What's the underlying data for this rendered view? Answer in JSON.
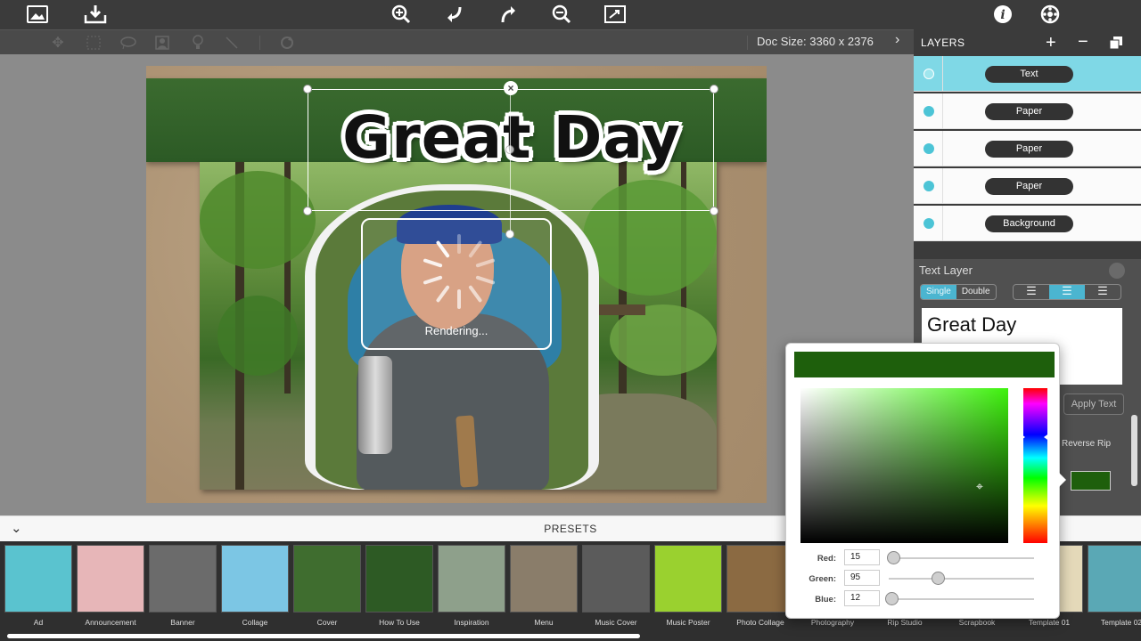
{
  "colors": {
    "accent": "#4bb5d0",
    "selected_layer": "#7fd8e6",
    "text_color": "#1e5f0c"
  },
  "topbar": {
    "icons": [
      "image-icon",
      "save-icon",
      "zoom-in-icon",
      "undo-icon",
      "redo-icon",
      "zoom-out-icon",
      "fit-screen-icon",
      "info-icon",
      "settings-icon"
    ],
    "doc_size": "Doc Size: 3360 x 2376"
  },
  "canvas": {
    "title_text": "Great Day",
    "rendering_message": "Rendering..."
  },
  "layers": {
    "header": "LAYERS",
    "items": [
      {
        "label": "Text",
        "selected": true
      },
      {
        "label": "Paper",
        "selected": false
      },
      {
        "label": "Paper",
        "selected": false
      },
      {
        "label": "Paper",
        "selected": false
      },
      {
        "label": "Background",
        "selected": false
      }
    ]
  },
  "text_layer": {
    "title": "Text Layer",
    "mode_single": "Single",
    "mode_double": "Double",
    "content": "Great Day",
    "apply_label": "Apply Text",
    "reverse_rip": "Reverse Rip"
  },
  "color_picker": {
    "red_label": "Red:",
    "red": "15",
    "green_label": "Green:",
    "green": "95",
    "blue_label": "Blue:",
    "blue": "12"
  },
  "presets": {
    "header": "PRESETS",
    "items": [
      {
        "label": "Ad",
        "color": "#5ac3cf"
      },
      {
        "label": "Announcement",
        "color": "#e7b6b8"
      },
      {
        "label": "Banner",
        "color": "#6b6b6b"
      },
      {
        "label": "Collage",
        "color": "#7cc6e4"
      },
      {
        "label": "Cover",
        "color": "#3f6d2f"
      },
      {
        "label": "How To Use",
        "color": "#2d5a24"
      },
      {
        "label": "Inspiration",
        "color": "#8ea08b"
      },
      {
        "label": "Menu",
        "color": "#8a7d6a"
      },
      {
        "label": "Music Cover",
        "color": "#5b5b5b"
      },
      {
        "label": "Music Poster",
        "color": "#9ad12f"
      },
      {
        "label": "Photo Collage",
        "color": "#8b6a42"
      },
      {
        "label": "Photography",
        "color": "#cccccc"
      },
      {
        "label": "Rip Studio",
        "color": "#cccccc"
      },
      {
        "label": "Scrapbook",
        "color": "#cccccc"
      },
      {
        "label": "Template 01",
        "color": "#e4d9b9"
      },
      {
        "label": "Template 02",
        "color": "#5aa8b5"
      }
    ]
  }
}
